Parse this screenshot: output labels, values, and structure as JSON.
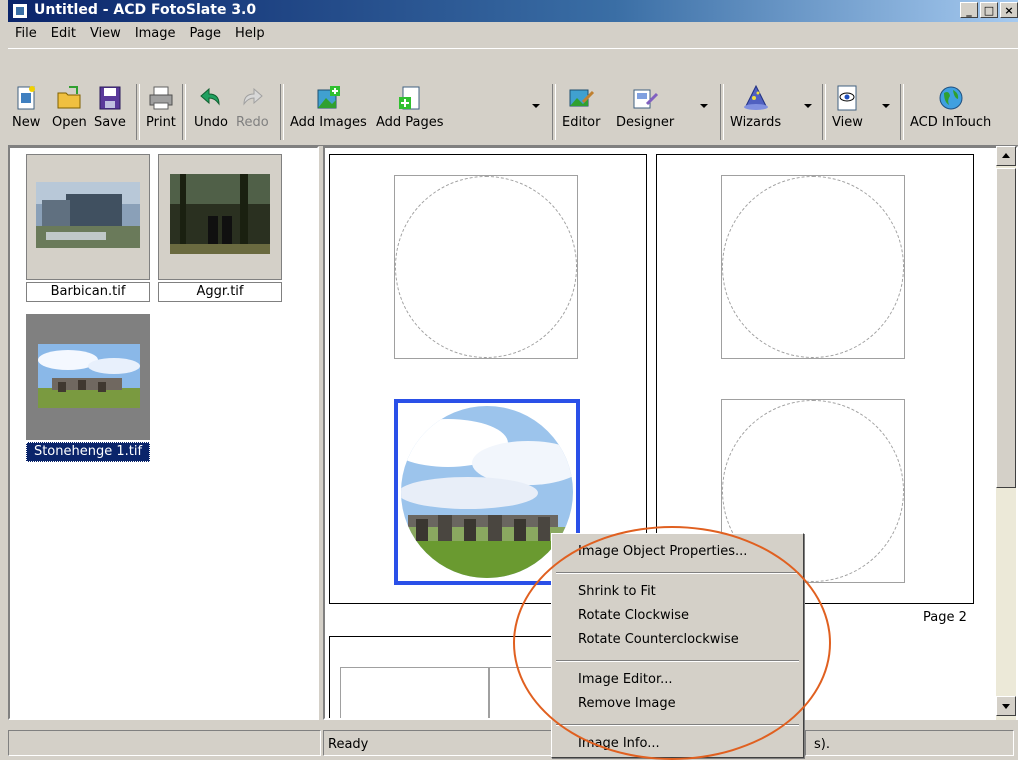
{
  "window": {
    "title": "Untitled - ACD FotoSlate 3.0"
  },
  "menubar": [
    "File",
    "Edit",
    "View",
    "Image",
    "Page",
    "Help"
  ],
  "toolbar": {
    "new": "New",
    "open": "Open",
    "save": "Save",
    "print": "Print",
    "undo": "Undo",
    "redo": "Redo",
    "add_images": "Add Images",
    "add_pages": "Add Pages",
    "editor": "Editor",
    "designer": "Designer",
    "wizards": "Wizards",
    "view": "View",
    "acd_intouch": "ACD InTouch"
  },
  "thumbnails": [
    {
      "name": "Barbican.tif"
    },
    {
      "name": "Aggr.tif"
    },
    {
      "name": "Stonehenge 1.tif"
    }
  ],
  "canvas": {
    "page2_label": "Page 2"
  },
  "context_menu": {
    "image_object_properties": "Image Object Properties...",
    "shrink_to_fit": "Shrink to Fit",
    "rotate_clockwise": "Rotate Clockwise",
    "rotate_counterclockwise": "Rotate Counterclockwise",
    "image_editor": "Image Editor...",
    "remove_image": "Remove Image",
    "image_info": "Image Info..."
  },
  "statusbar": {
    "text": "Ready",
    "partial_text": "s)."
  },
  "colors": {
    "title_bar": "#0a246a",
    "annotation": "#e06020",
    "selection_frame": "#2a50e8"
  }
}
